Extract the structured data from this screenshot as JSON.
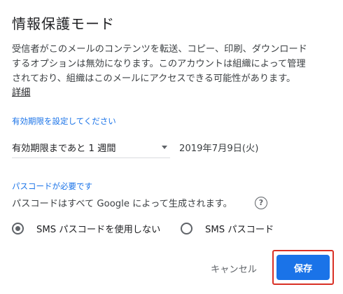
{
  "dialog": {
    "title": "情報保護モード",
    "description_lines": [
      "受信者がこのメールのコンテンツを転送、コピー、印刷、ダウンロード",
      "するオプションは無効になります。このアカウントは組織によって管理",
      "されており、組織はこのメールにアクセスできる可能性があります。"
    ],
    "learn_more": "詳細"
  },
  "expiration": {
    "section_label": "有効期限を設定してください",
    "selected": "有効期限まであと 1 週間",
    "date": "2019年7月9日(火)"
  },
  "passcode": {
    "section_label": "パスコードが必要です",
    "info": "パスコードはすべて Google によって生成されます。",
    "help_icon": "?",
    "options": [
      {
        "label": "SMS パスコードを使用しない",
        "selected": true
      },
      {
        "label": "SMS パスコード",
        "selected": false
      }
    ]
  },
  "actions": {
    "cancel": "キャンセル",
    "save": "保存"
  },
  "colors": {
    "accent": "#1a73e8",
    "highlight": "#d93025"
  }
}
